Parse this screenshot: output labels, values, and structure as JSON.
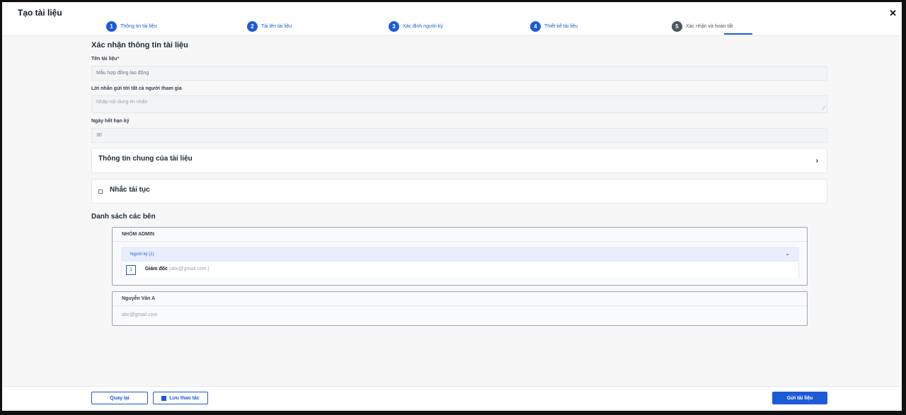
{
  "header": {
    "title": "Tạo tài liệu",
    "close": "✕",
    "steps": [
      {
        "num": "1",
        "label": "Thông tin tài liệu"
      },
      {
        "num": "2",
        "label": "Tải lên tài liệu"
      },
      {
        "num": "3",
        "label": "Xác định người ký"
      },
      {
        "num": "4",
        "label": "Thiết kế tài liệu"
      },
      {
        "num": "5",
        "label": "Xác nhận và hoàn tất"
      }
    ]
  },
  "form": {
    "section_title": "Xác nhận thông tin tài liệu",
    "doc_name_label": "Tên tài liệu",
    "required_mark": "*",
    "doc_name_value": "Mẫu hợp đồng lao động",
    "message_label": "Lời nhắn gửi tới tất cả người tham gia",
    "message_placeholder": "Nhập nội dung tin nhắn",
    "expiry_label": "Ngày hết hạn ký",
    "expiry_value": "30"
  },
  "panels": {
    "general_info": "Thông tin chung của tài liệu",
    "reminder": "Nhắc tái tục"
  },
  "parties": {
    "title": "Danh sách các bên",
    "groups": [
      {
        "name": "NHÓM ADMIN",
        "role": "Người ký (1)",
        "order": "1",
        "signer_name": "Giám đốc",
        "signer_email": "(abc@gmail.com )"
      },
      {
        "name": "Nguyễn Văn A",
        "email": "abc@gmail.com"
      }
    ]
  },
  "footer": {
    "back": "Quay lại",
    "save": "Lưu thao tác",
    "send": "Gửi tài liệu"
  },
  "colors": {
    "accent": "#1d5bd6",
    "inactive_step": "#4b5563"
  }
}
